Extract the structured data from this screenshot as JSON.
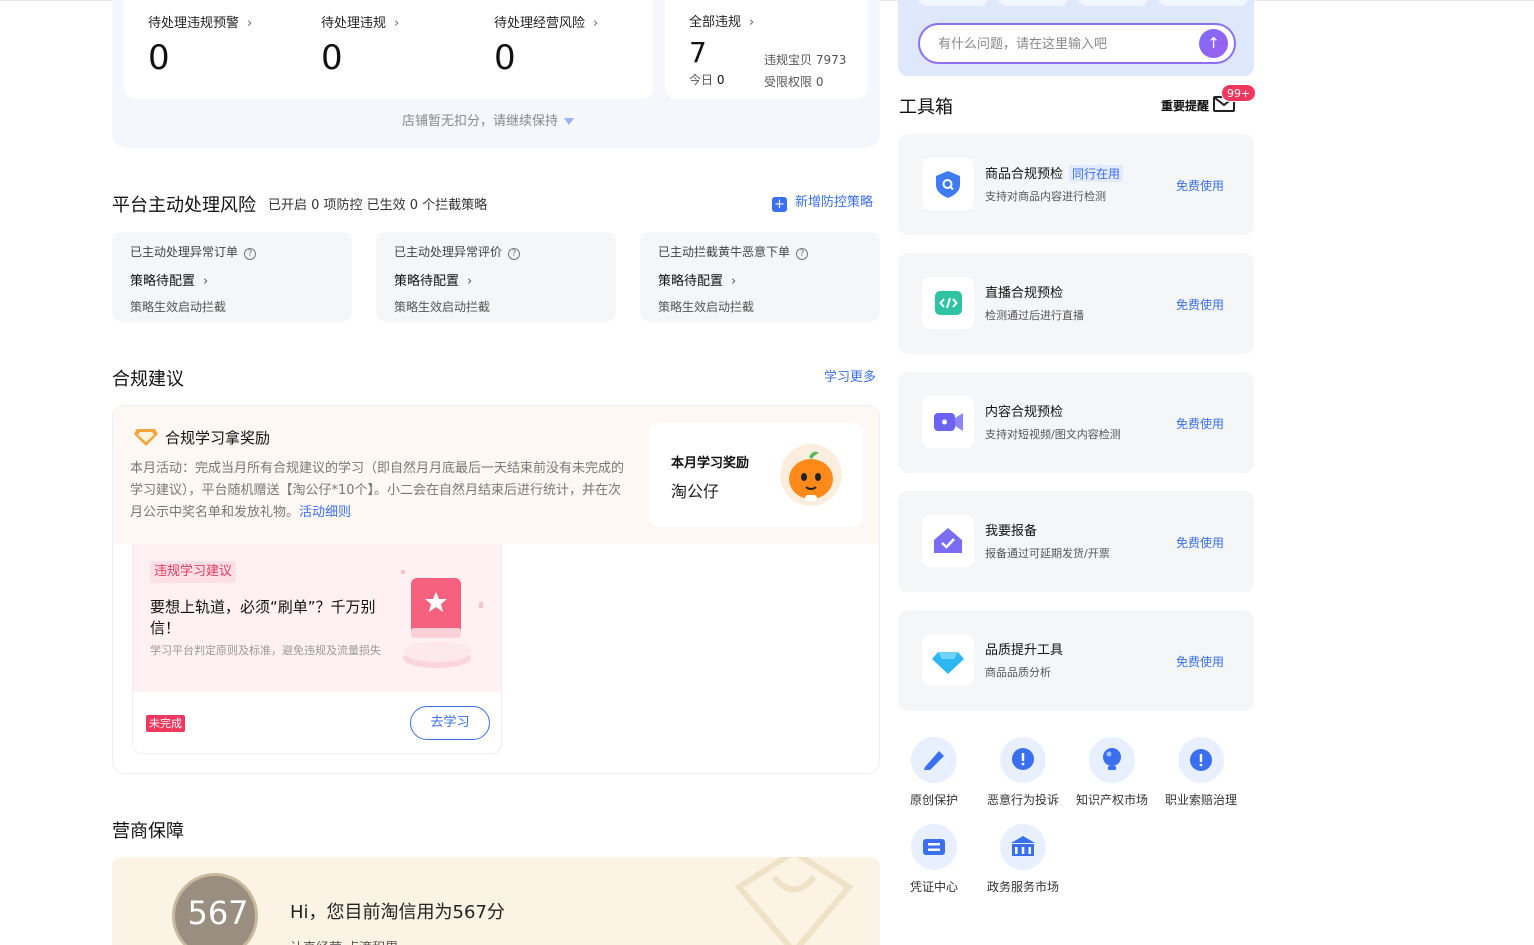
{
  "stats": {
    "pending_warning": {
      "label": "待处理违规预警",
      "value": "0"
    },
    "pending_violation": {
      "label": "待处理违规",
      "value": "0"
    },
    "pending_risk": {
      "label": "待处理经营风险",
      "value": "0"
    },
    "all_violation": {
      "label": "全部违规",
      "value": "7",
      "today_label": "今日",
      "today_value": "0",
      "baobei": "违规宝贝 7973",
      "limited": "受限权限 0"
    },
    "no_deduction": "店铺暂无扣分，请继续保持"
  },
  "platform_risk": {
    "title": "平台主动处理风险",
    "subtitle": "已开启 0 项防控 已生效 0 个拦截策略",
    "add_label": "新增防控策略",
    "cards": [
      {
        "label": "已主动处理异常订单",
        "status": "策略待配置",
        "note": "策略生效启动拦截"
      },
      {
        "label": "已主动处理异常评价",
        "status": "策略待配置",
        "note": "策略生效启动拦截"
      },
      {
        "label": "已主动拦截黄牛恶意下单",
        "status": "策略待配置",
        "note": "策略生效启动拦截"
      }
    ]
  },
  "compliance": {
    "title": "合规建议",
    "learn_more": "学习更多",
    "banner_title": "合规学习拿奖励",
    "banner_desc": "本月活动：完成当月所有合规建议的学习（即自然月月底最后一天结束前没有未完成的学习建议），平台随机赠送【淘公仔*10个】。小二会在自然月结束后进行统计，并在次月公示中奖名单和发放礼物。",
    "banner_link": "活动细则",
    "reward_label": "本月学习奖励",
    "reward_value": "淘公仔",
    "card": {
      "tag": "违规学习建议",
      "title": "要想上轨道，必须“刷单”？千万别信！",
      "desc": "学习平台判定原则及标准，避免违规及流量损失",
      "status": "未完成",
      "button": "去学习"
    }
  },
  "merchant": {
    "title": "营商保障",
    "score": "567",
    "greeting": "Hi，您目前淘信用为567分",
    "sub": "认真经营 点滴积累"
  },
  "search": {
    "placeholder": "有什么问题，请在这里输入吧"
  },
  "toolbox": {
    "title": "工具箱",
    "reminder": "重要提醒",
    "badge": "99+",
    "free_label": "免费使用",
    "tools": [
      {
        "name": "商品合规预检",
        "tag": "同行在用",
        "desc": "支持对商品内容进行检测"
      },
      {
        "name": "直播合规预检",
        "tag": "",
        "desc": "检测通过后进行直播"
      },
      {
        "name": "内容合规预检",
        "tag": "",
        "desc": "支持对短视频/图文内容检测"
      },
      {
        "name": "我要报备",
        "tag": "",
        "desc": "报备通过可延期发货/开票"
      },
      {
        "name": "品质提升工具",
        "tag": "",
        "desc": "商品品质分析"
      }
    ],
    "quick": [
      "原创保护",
      "恶意行为投诉",
      "知识产权市场",
      "职业索赔治理",
      "凭证中心",
      "政务服务市场"
    ]
  },
  "colors": {
    "accent": "#3a6ff0",
    "danger": "#f0385e",
    "purple": "#8b6ff5"
  }
}
